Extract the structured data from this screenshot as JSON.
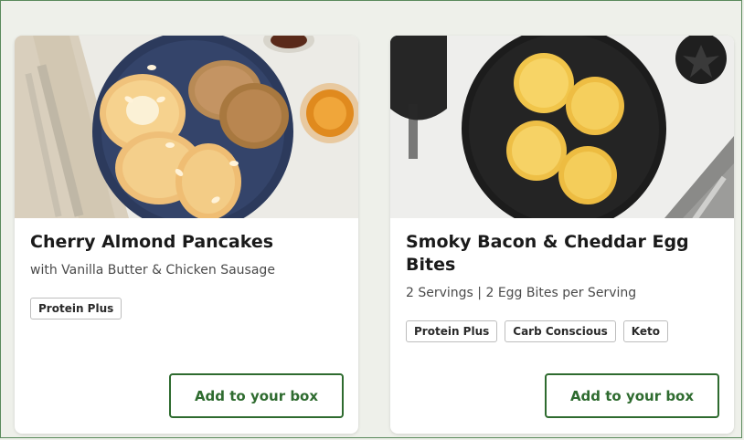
{
  "cards": [
    {
      "title": "Cherry Almond Pancakes",
      "subtitle": "with Vanilla Butter & Chicken Sausage",
      "tags": [
        "Protein Plus"
      ],
      "button_label": "Add to your box",
      "image_alt_icon": "pancakes-photo"
    },
    {
      "title": "Smoky Bacon & Cheddar Egg Bites",
      "subtitle": "2 Servings | 2 Egg Bites per Serving",
      "tags": [
        "Protein Plus",
        "Carb Conscious",
        "Keto"
      ],
      "button_label": "Add to your box",
      "image_alt_icon": "egg-bites-photo"
    }
  ],
  "colors": {
    "accent_green": "#2e6b2f",
    "page_bg": "#eef0ea",
    "card_bg": "#ffffff"
  }
}
